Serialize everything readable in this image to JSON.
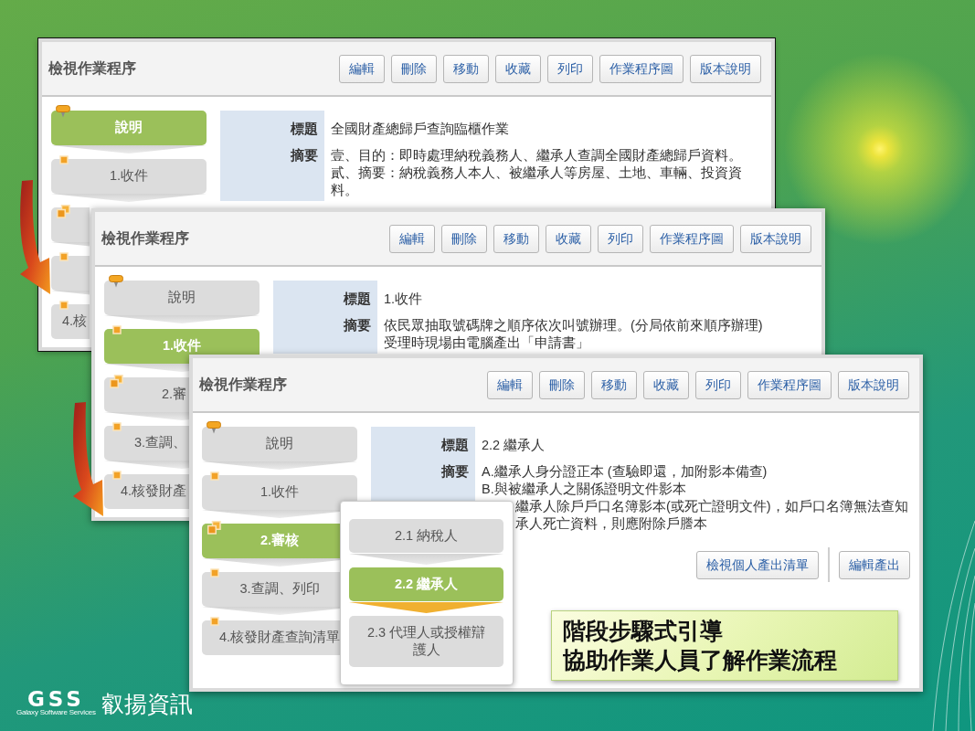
{
  "windows": [
    {
      "title": "檢視作業程序",
      "buttons": [
        "編輯",
        "刪除",
        "移動",
        "收藏",
        "列印",
        "作業程序圖",
        "版本說明"
      ],
      "steps": [
        {
          "label": "說明",
          "kind": "overview",
          "selected": true,
          "covered": false
        },
        {
          "label": "1.收件",
          "kind": "task",
          "selected": false,
          "covered": false
        },
        {
          "kind": "group",
          "selected": false,
          "covered": true
        },
        {
          "kind": "task",
          "selected": false,
          "covered": true
        },
        {
          "label": "4.核",
          "kind": "task",
          "selected": false,
          "covered": true
        }
      ],
      "fields": [
        {
          "label": "標題",
          "lines": [
            {
              "text": "全國財產總歸戶查詢臨櫃作業"
            }
          ]
        },
        {
          "label": "摘要",
          "lines": [
            {
              "text": "壹、目的：即時處理納稅義務人、繼承人查調全國財產總歸戶資料。"
            },
            {
              "text": "貳、摘要：納稅義務人本人、被繼承人等房屋、土地、車輛、投資資"
            },
            {
              "text": "料。"
            }
          ]
        }
      ]
    },
    {
      "title": "檢視作業程序",
      "buttons": [
        "編輯",
        "刪除",
        "移動",
        "收藏",
        "列印",
        "作業程序圖",
        "版本說明"
      ],
      "steps": [
        {
          "label": "說明",
          "kind": "overview",
          "selected": false,
          "covered": false
        },
        {
          "label": "1.收件",
          "kind": "task",
          "selected": true,
          "covered": false
        },
        {
          "label": "2.審",
          "kind": "group",
          "selected": false,
          "covered": true
        },
        {
          "label": "3.查調、",
          "kind": "task",
          "selected": false,
          "covered": true
        },
        {
          "label": "4.核發財產",
          "kind": "task",
          "selected": false,
          "covered": true
        }
      ],
      "fields": [
        {
          "label": "標題",
          "lines": [
            {
              "text": "1.收件"
            }
          ]
        },
        {
          "label": "摘要",
          "lines": [
            {
              "text": "依民眾抽取號碼牌之順序依次叫號辦理。(分局依前來順序辦理)"
            },
            {
              "text": "受理時現場由電腦產出「申請書」"
            }
          ]
        }
      ]
    },
    {
      "title": "檢視作業程序",
      "buttons": [
        "編輯",
        "刪除",
        "移動",
        "收藏",
        "列印",
        "作業程序圖",
        "版本說明"
      ],
      "steps": [
        {
          "label": "說明",
          "kind": "overview",
          "selected": false,
          "covered": false
        },
        {
          "label": "1.收件",
          "kind": "task",
          "selected": false,
          "covered": false
        },
        {
          "label": "2.審核",
          "kind": "group",
          "selected": true,
          "covered": false
        },
        {
          "label": "3.查調、列印",
          "kind": "task",
          "selected": false,
          "covered": false
        },
        {
          "label": "4.核發財產查詢清單",
          "kind": "task",
          "selected": false,
          "covered": false
        }
      ],
      "fields": [
        {
          "label": "標題",
          "lines": [
            {
              "text": "2.2 繼承人"
            }
          ]
        },
        {
          "label": "摘要",
          "lines": [
            {
              "text": "A.繼承人身分證正本 (查驗即還，加附影本備查)"
            },
            {
              "text": "B.與被繼承人之關係證明文件影本"
            },
            {
              "text": "繼承人除戶戶口名簿影本(或死亡證明文件)，如戶口名簿無法查知",
              "covered": true
            },
            {
              "text": "承人死亡資料，則應附除戶謄本",
              "covered": true
            }
          ]
        }
      ],
      "actions": [
        "檢視個人產出清單",
        "編輯產出"
      ],
      "substeps": [
        {
          "label": "2.1 納稅人",
          "selected": false
        },
        {
          "label": "2.2 繼承人",
          "selected": true
        },
        {
          "label": "2.3 代理人或授權辯護人",
          "selected": false
        }
      ]
    }
  ],
  "callout": {
    "lines": [
      "階段步驟式引導",
      "協助作業人員了解作業流程"
    ]
  },
  "logo": {
    "mark": "GSS",
    "tagline": "Galaxy Software Services",
    "name": "叡揚資訊"
  }
}
